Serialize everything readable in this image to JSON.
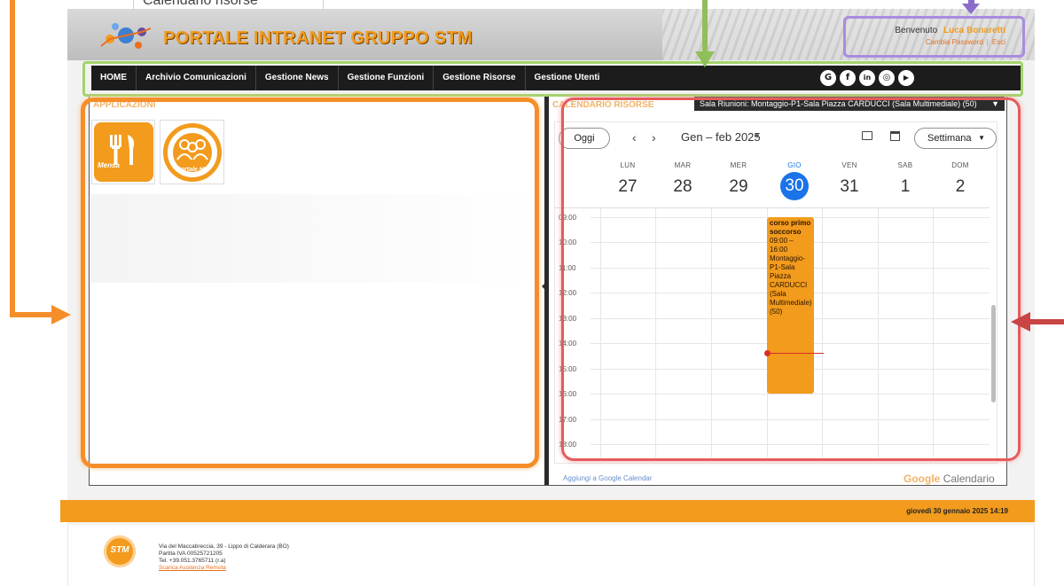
{
  "callout": {
    "text": "Calendario risorse"
  },
  "header": {
    "title": "PORTALE INTRANET GRUPPO STM",
    "welcome_prefix": "Benvenuto",
    "user_name": "Luca Bonaretti",
    "change_password": "Cambia Password",
    "logout": "Esci"
  },
  "nav": {
    "items": [
      {
        "label": "HOME"
      },
      {
        "label": "Archivio Comunicazioni"
      },
      {
        "label": "Gestione News"
      },
      {
        "label": "Gestione Funzioni"
      },
      {
        "label": "Gestione Risorse"
      },
      {
        "label": "Gestione Utenti"
      }
    ],
    "social": [
      {
        "icon": "google-icon",
        "glyph": "G"
      },
      {
        "icon": "facebook-icon",
        "glyph": "f"
      },
      {
        "icon": "linkedin-icon",
        "glyph": "in"
      },
      {
        "icon": "instagram-icon",
        "glyph": "◎"
      },
      {
        "icon": "youtube-icon",
        "glyph": "▶"
      }
    ]
  },
  "apps": {
    "title": "APPLICAZIONI",
    "items": [
      {
        "label": "Mensa",
        "icon": "cutlery-icon"
      },
      {
        "label": "Portale HR",
        "icon": "people-icon"
      }
    ]
  },
  "calendar": {
    "title": "CALENDARIO RISORSE",
    "resource_selected": "Sala Riunioni: Montaggio-P1-Sala Piazza CARDUCCI (Sala Multimediale) (50)",
    "today_button": "Oggi",
    "range_label": "Gen – feb 2025",
    "view_label": "Settimana",
    "days": [
      {
        "name": "LUN",
        "num": "27"
      },
      {
        "name": "MAR",
        "num": "28"
      },
      {
        "name": "MER",
        "num": "29"
      },
      {
        "name": "GIO",
        "num": "30",
        "today": true
      },
      {
        "name": "VEN",
        "num": "31"
      },
      {
        "name": "SAB",
        "num": "1"
      },
      {
        "name": "DOM",
        "num": "2"
      }
    ],
    "hours": [
      "09:00",
      "10:00",
      "11:00",
      "12:00",
      "13:00",
      "14:00",
      "15:00",
      "16:00",
      "17:00",
      "18:00"
    ],
    "event": {
      "title": "corso primo soccorso",
      "time": "09:00 – 16:00",
      "location": "Montaggio-P1-Sala Piazza CARDUCCI (Sala Multimediale) (50)",
      "color": "#f29b1d"
    },
    "add_link": "Aggiungi a Google Calendar",
    "brand_google": "Google",
    "brand_suffix": "Calendario"
  },
  "status": {
    "datetime": "giovedì 30 gennaio 2025 14:19"
  },
  "footer": {
    "logo_text": "STM",
    "address": "Via del Maccabreccia, 39 - Lippo di Calderara (BO)",
    "vat": "Partita IVA 00525721205",
    "phone": "Tel. +39.051.3765711 (r.a)",
    "remote_link": "Scarica Assitenza Remota"
  },
  "colors": {
    "accent": "#f29b1d",
    "nav_bg": "#1c1c1c",
    "today_blue": "#1a73e8",
    "now_red": "#d93025"
  }
}
